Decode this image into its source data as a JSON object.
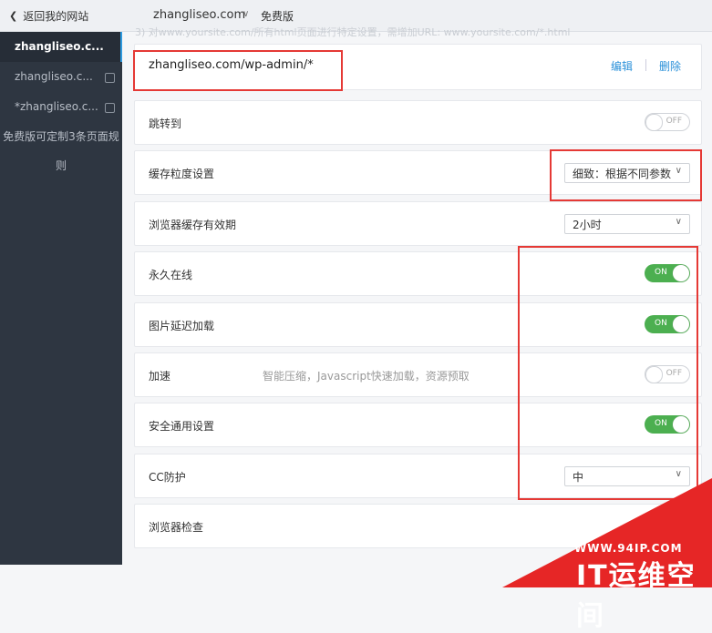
{
  "topbar": {
    "back_label": "返回我的网站",
    "domain": "zhangliseo.com",
    "plan": "免费版"
  },
  "sidebar": {
    "items": [
      {
        "label": "zhangliseo.c..."
      },
      {
        "label": "zhangliseo.c..."
      },
      {
        "label": "*zhangliseo.c..."
      }
    ],
    "note_line1": "免费版可定制3条页面规",
    "note_line2": "则"
  },
  "main": {
    "hint": "3) 对www.yoursite.com/所有html页面进行特定设置，需增加URL: www.yoursite.com/*.html",
    "rule": {
      "url": "zhangliseo.com/wp-admin/*",
      "edit": "编辑",
      "delete": "删除"
    },
    "rows": {
      "redirect": {
        "label": "跳转到",
        "toggle": "OFF",
        "on": false
      },
      "cache": {
        "label": "缓存粒度设置",
        "value": "细致：根据不同参数"
      },
      "browser_cache": {
        "label": "浏览器缓存有效期",
        "value": "2小时"
      },
      "always_online": {
        "label": "永久在线",
        "toggle": "ON",
        "on": true
      },
      "lazy_load": {
        "label": "图片延迟加载",
        "toggle": "ON",
        "on": true
      },
      "accelerate": {
        "label": "加速",
        "desc": "智能压缩，Javascript快速加载，资源预取",
        "toggle": "OFF",
        "on": false
      },
      "security": {
        "label": "安全通用设置",
        "toggle": "ON",
        "on": true
      },
      "cc": {
        "label": "CC防护",
        "value": "中"
      },
      "browser_check": {
        "label": "浏览器检查"
      }
    }
  },
  "watermark": {
    "small": "WWW.94IP.COM",
    "big": "IT运维空间"
  },
  "colors": {
    "sidebar_bg": "#2e3641",
    "accent": "#2b91d9",
    "toggle_on": "#4caf50",
    "highlight": "#e53935"
  }
}
